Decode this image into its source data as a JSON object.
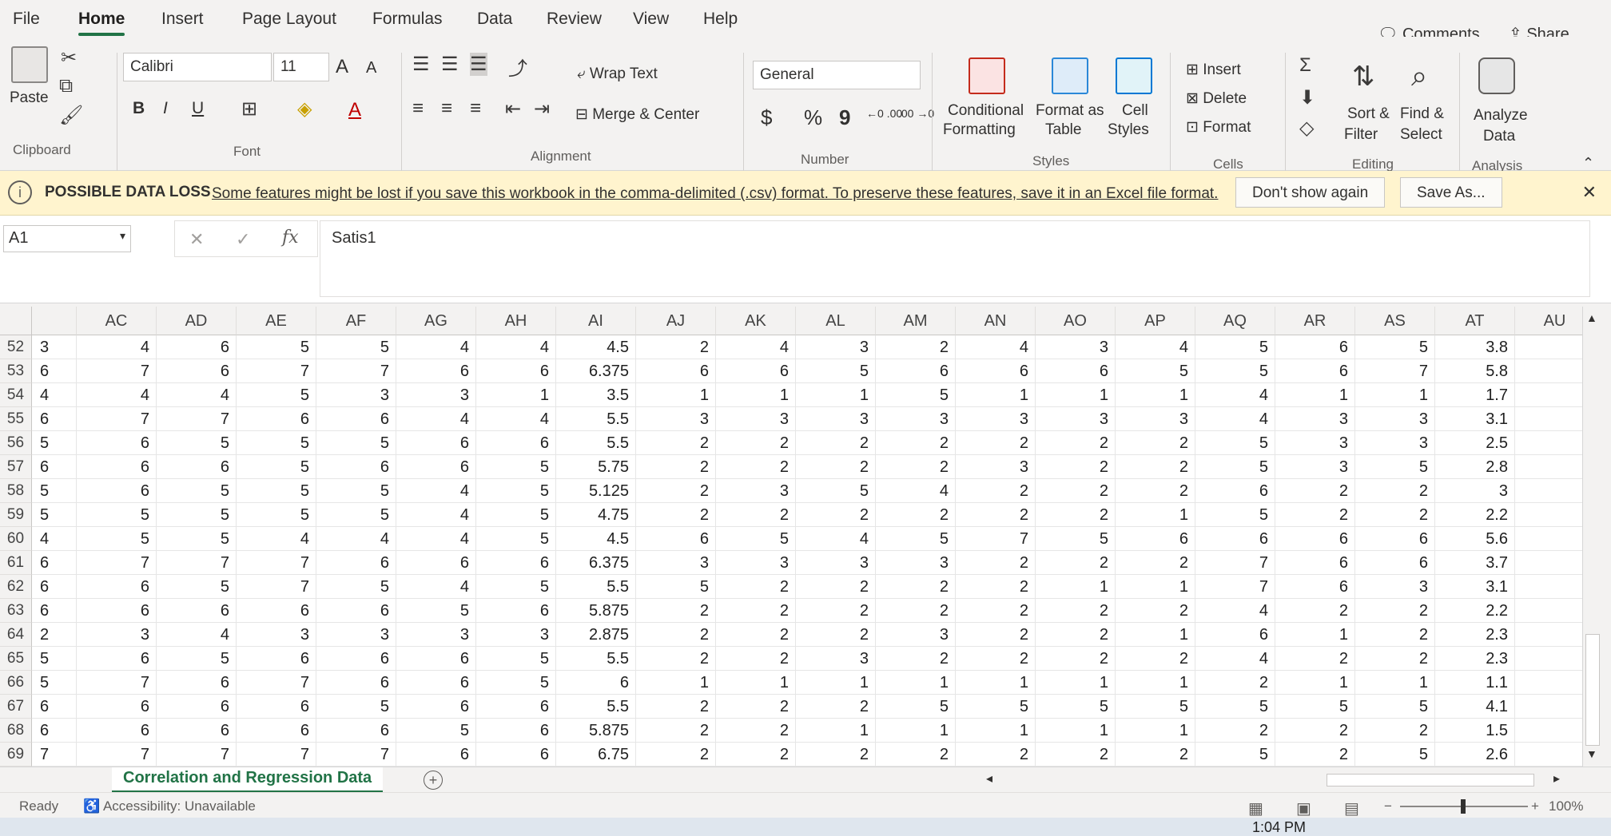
{
  "menu": {
    "tabs": [
      "File",
      "Home",
      "Insert",
      "Page Layout",
      "Formulas",
      "Data",
      "Review",
      "View",
      "Help"
    ],
    "comments": "Comments",
    "share": "Share"
  },
  "ribbon": {
    "clipboard": {
      "paste": "Paste",
      "label": "Clipboard"
    },
    "font": {
      "name": "Calibri",
      "size": "11",
      "bold": "B",
      "italic": "I",
      "underline": "U",
      "grow": "A",
      "shrink": "A",
      "font_color": "A",
      "label": "Font"
    },
    "alignment": {
      "wrap_text": "Wrap Text",
      "merge_center": "Merge & Center",
      "label": "Alignment"
    },
    "number": {
      "format": "General",
      "currency": "$",
      "percent": "%",
      "comma": "9",
      "inc_decimal": "←0\n.00",
      "dec_decimal": ".00\n→0",
      "label": "Number"
    },
    "styles": {
      "conditional": "Conditional",
      "conditional2": "Formatting",
      "format_as": "Format as",
      "format_as2": "Table",
      "cell_styles": "Cell",
      "cell_styles2": "Styles",
      "label": "Styles"
    },
    "cells": {
      "insert": "Insert",
      "delete": "Delete",
      "format": "Format",
      "label": "Cells"
    },
    "editing": {
      "sort": "Sort &",
      "sort2": "Filter",
      "find": "Find &",
      "find2": "Select",
      "label": "Editing"
    },
    "analysis": {
      "analyze": "Analyze",
      "analyze2": "Data",
      "label": "Analysis"
    }
  },
  "message_bar": {
    "title": "POSSIBLE DATA LOSS",
    "text": "Some features might be lost if you save this workbook in the comma-delimited (.csv) format. To preserve these features, save it in an Excel file format.",
    "dont_show": "Don't show again",
    "save_as": "Save As...",
    "info_icon": "i",
    "close_icon": "✕"
  },
  "formula_bar": {
    "name_box": "A1",
    "cancel": "✕",
    "enter": "✓",
    "fx": "fx",
    "content": "Satis1"
  },
  "grid": {
    "columns": [
      "AC",
      "AD",
      "AE",
      "AF",
      "AG",
      "AH",
      "AI",
      "AJ",
      "AK",
      "AL",
      "AM",
      "AN",
      "AO",
      "AP",
      "AQ",
      "AR",
      "AS",
      "AT",
      "AU"
    ],
    "rows": [
      {
        "num": "52",
        "first": "3",
        "cells": [
          "4",
          "6",
          "5",
          "5",
          "4",
          "4",
          "4.5",
          "2",
          "4",
          "3",
          "2",
          "4",
          "3",
          "4",
          "5",
          "6",
          "5",
          "3.8",
          ""
        ]
      },
      {
        "num": "53",
        "first": "6",
        "cells": [
          "7",
          "6",
          "7",
          "7",
          "6",
          "6",
          "6.375",
          "6",
          "6",
          "5",
          "6",
          "6",
          "6",
          "5",
          "5",
          "6",
          "7",
          "5.8",
          ""
        ]
      },
      {
        "num": "54",
        "first": "4",
        "cells": [
          "4",
          "4",
          "5",
          "3",
          "3",
          "1",
          "3.5",
          "1",
          "1",
          "1",
          "5",
          "1",
          "1",
          "1",
          "4",
          "1",
          "1",
          "1.7",
          ""
        ]
      },
      {
        "num": "55",
        "first": "6",
        "cells": [
          "7",
          "7",
          "6",
          "6",
          "4",
          "4",
          "5.5",
          "3",
          "3",
          "3",
          "3",
          "3",
          "3",
          "3",
          "4",
          "3",
          "3",
          "3.1",
          ""
        ]
      },
      {
        "num": "56",
        "first": "5",
        "cells": [
          "6",
          "5",
          "5",
          "5",
          "6",
          "6",
          "5.5",
          "2",
          "2",
          "2",
          "2",
          "2",
          "2",
          "2",
          "5",
          "3",
          "3",
          "2.5",
          ""
        ]
      },
      {
        "num": "57",
        "first": "6",
        "cells": [
          "6",
          "6",
          "5",
          "6",
          "6",
          "5",
          "5.75",
          "2",
          "2",
          "2",
          "2",
          "3",
          "2",
          "2",
          "5",
          "3",
          "5",
          "2.8",
          ""
        ]
      },
      {
        "num": "58",
        "first": "5",
        "cells": [
          "6",
          "5",
          "5",
          "5",
          "4",
          "5",
          "5.125",
          "2",
          "3",
          "5",
          "4",
          "2",
          "2",
          "2",
          "6",
          "2",
          "2",
          "3",
          ""
        ]
      },
      {
        "num": "59",
        "first": "5",
        "cells": [
          "5",
          "5",
          "5",
          "5",
          "4",
          "5",
          "4.75",
          "2",
          "2",
          "2",
          "2",
          "2",
          "2",
          "1",
          "5",
          "2",
          "2",
          "2.2",
          ""
        ]
      },
      {
        "num": "60",
        "first": "4",
        "cells": [
          "5",
          "5",
          "4",
          "4",
          "4",
          "5",
          "4.5",
          "6",
          "5",
          "4",
          "5",
          "7",
          "5",
          "6",
          "6",
          "6",
          "6",
          "5.6",
          ""
        ]
      },
      {
        "num": "61",
        "first": "6",
        "cells": [
          "7",
          "7",
          "7",
          "6",
          "6",
          "6",
          "6.375",
          "3",
          "3",
          "3",
          "3",
          "2",
          "2",
          "2",
          "7",
          "6",
          "6",
          "3.7",
          ""
        ]
      },
      {
        "num": "62",
        "first": "6",
        "cells": [
          "6",
          "5",
          "7",
          "5",
          "4",
          "5",
          "5.5",
          "5",
          "2",
          "2",
          "2",
          "2",
          "1",
          "1",
          "7",
          "6",
          "3",
          "3.1",
          ""
        ]
      },
      {
        "num": "63",
        "first": "6",
        "cells": [
          "6",
          "6",
          "6",
          "6",
          "5",
          "6",
          "5.875",
          "2",
          "2",
          "2",
          "2",
          "2",
          "2",
          "2",
          "4",
          "2",
          "2",
          "2.2",
          ""
        ]
      },
      {
        "num": "64",
        "first": "2",
        "cells": [
          "3",
          "4",
          "3",
          "3",
          "3",
          "3",
          "2.875",
          "2",
          "2",
          "2",
          "3",
          "2",
          "2",
          "1",
          "6",
          "1",
          "2",
          "2.3",
          ""
        ]
      },
      {
        "num": "65",
        "first": "5",
        "cells": [
          "6",
          "5",
          "6",
          "6",
          "6",
          "5",
          "5.5",
          "2",
          "2",
          "3",
          "2",
          "2",
          "2",
          "2",
          "4",
          "2",
          "2",
          "2.3",
          ""
        ]
      },
      {
        "num": "66",
        "first": "5",
        "cells": [
          "7",
          "6",
          "7",
          "6",
          "6",
          "5",
          "6",
          "1",
          "1",
          "1",
          "1",
          "1",
          "1",
          "1",
          "2",
          "1",
          "1",
          "1.1",
          ""
        ]
      },
      {
        "num": "67",
        "first": "6",
        "cells": [
          "6",
          "6",
          "6",
          "5",
          "6",
          "6",
          "5.5",
          "2",
          "2",
          "2",
          "5",
          "5",
          "5",
          "5",
          "5",
          "5",
          "5",
          "4.1",
          ""
        ]
      },
      {
        "num": "68",
        "first": "6",
        "cells": [
          "6",
          "6",
          "6",
          "6",
          "5",
          "6",
          "5.875",
          "2",
          "2",
          "1",
          "1",
          "1",
          "1",
          "1",
          "2",
          "2",
          "2",
          "1.5",
          ""
        ]
      },
      {
        "num": "69",
        "first": "7",
        "cells": [
          "7",
          "7",
          "7",
          "7",
          "6",
          "6",
          "6.75",
          "2",
          "2",
          "2",
          "2",
          "2",
          "2",
          "2",
          "5",
          "2",
          "5",
          "2.6",
          ""
        ]
      }
    ]
  },
  "sheets": {
    "active": "Correlation and Regression Data",
    "add": "+"
  },
  "status": {
    "ready": "Ready",
    "accessibility": "Accessibility: Unavailable",
    "zoom": "100%"
  },
  "taskbar": {
    "time": "1:04 PM"
  },
  "colors": {
    "accent": "#217346",
    "message_bg": "#fff4ce"
  }
}
